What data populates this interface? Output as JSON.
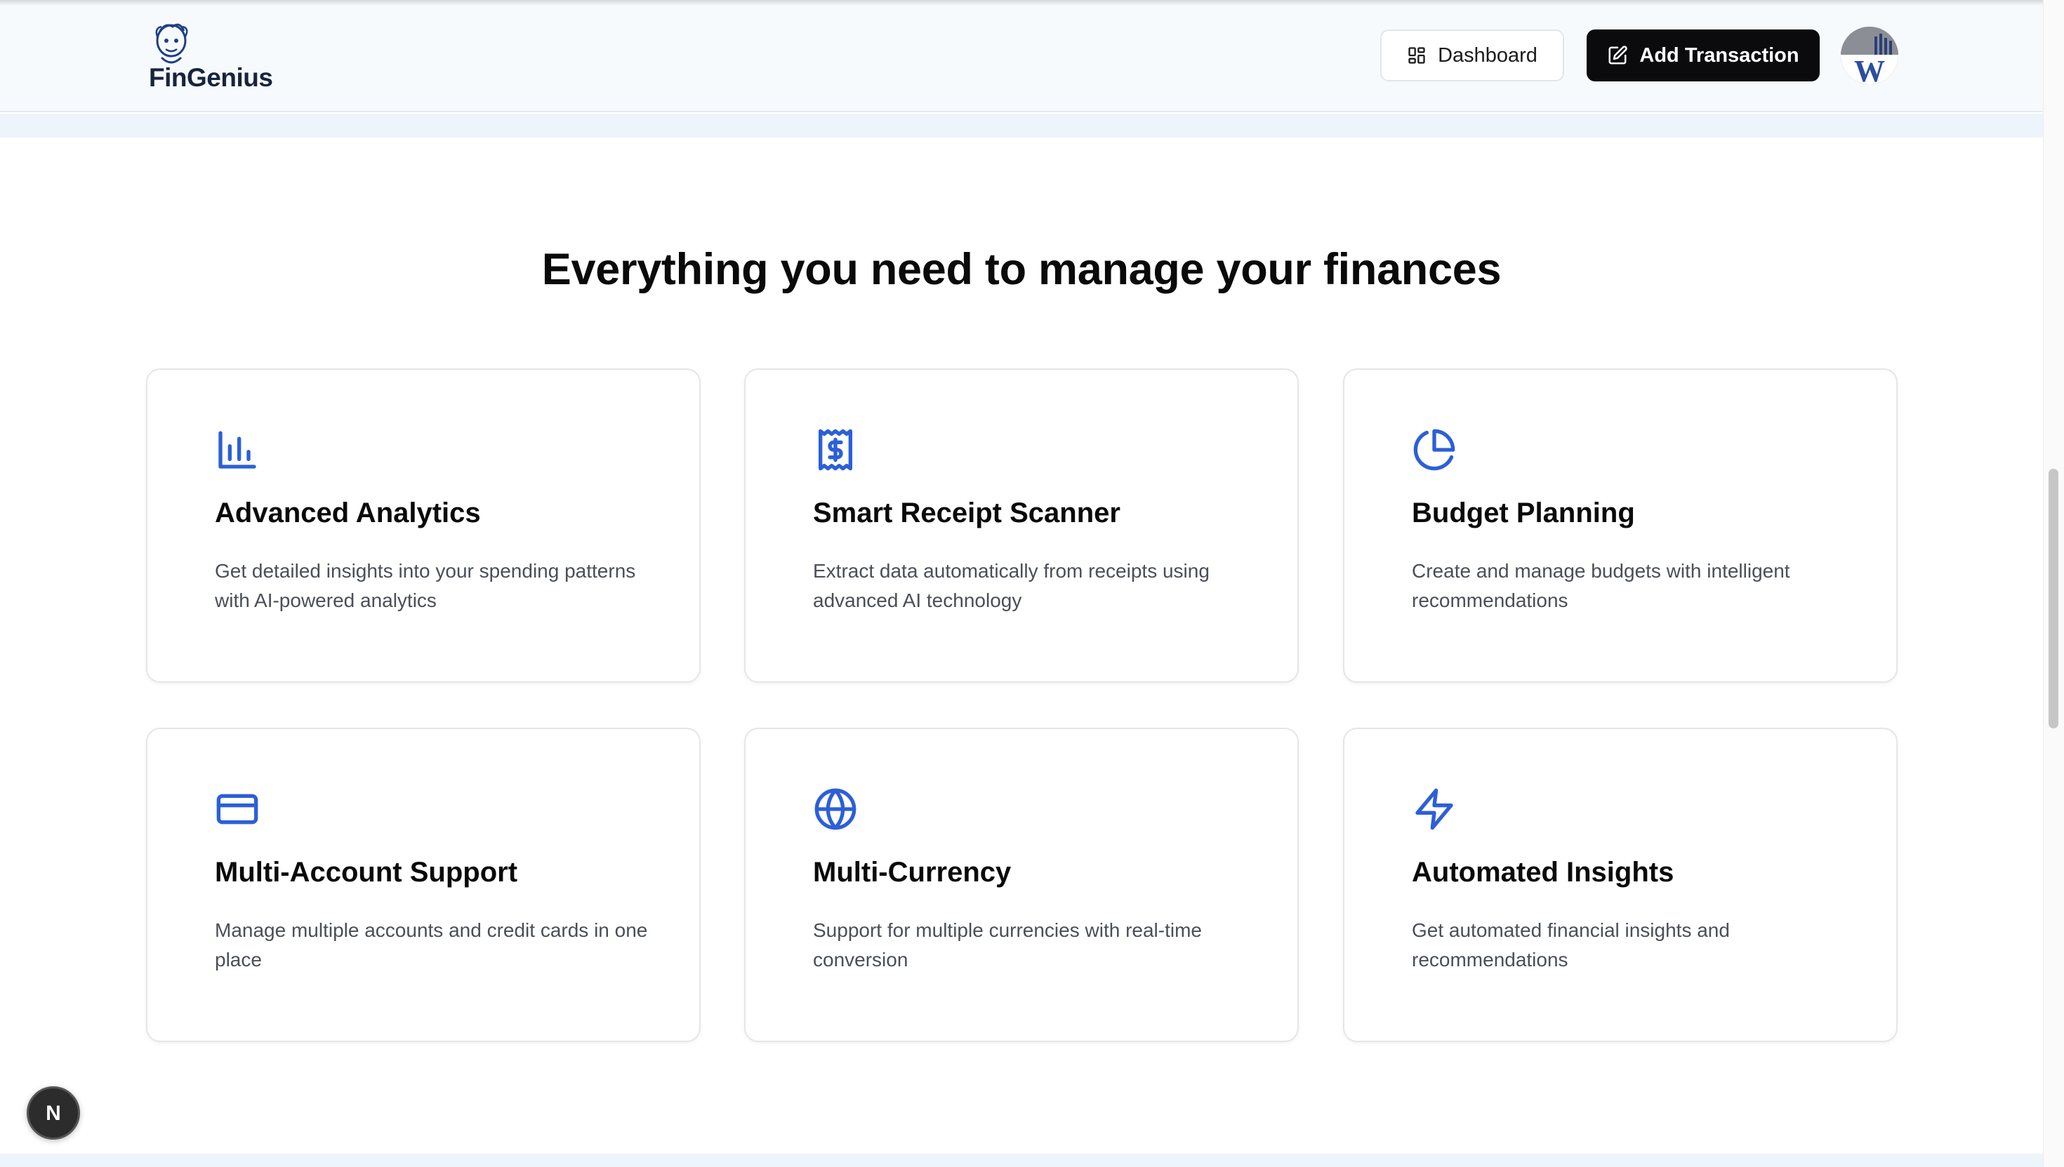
{
  "header": {
    "logo_text": "FinGenius",
    "dashboard_label": "Dashboard",
    "add_transaction_label": "Add Transaction",
    "avatar_letter": "W"
  },
  "main": {
    "title": "Everything you need to manage your finances",
    "features": [
      {
        "icon": "bar-chart-icon",
        "title": "Advanced Analytics",
        "description": "Get detailed insights into your spending patterns with AI-powered analytics"
      },
      {
        "icon": "receipt-icon",
        "title": "Smart Receipt Scanner",
        "description": "Extract data automatically from receipts using advanced AI technology"
      },
      {
        "icon": "pie-chart-icon",
        "title": "Budget Planning",
        "description": "Create and manage budgets with intelligent recommendations"
      },
      {
        "icon": "credit-card-icon",
        "title": "Multi-Account Support",
        "description": "Manage multiple accounts and credit cards in one place"
      },
      {
        "icon": "globe-icon",
        "title": "Multi-Currency",
        "description": "Support for multiple currencies with real-time conversion"
      },
      {
        "icon": "zap-icon",
        "title": "Automated Insights",
        "description": "Get automated financial insights and recommendations"
      }
    ]
  },
  "colors": {
    "accent": "#2c5fd8",
    "primary_button": "#0b0b0d",
    "header_bg": "#f7fafd"
  },
  "dev_badge": {
    "letter": "N"
  }
}
